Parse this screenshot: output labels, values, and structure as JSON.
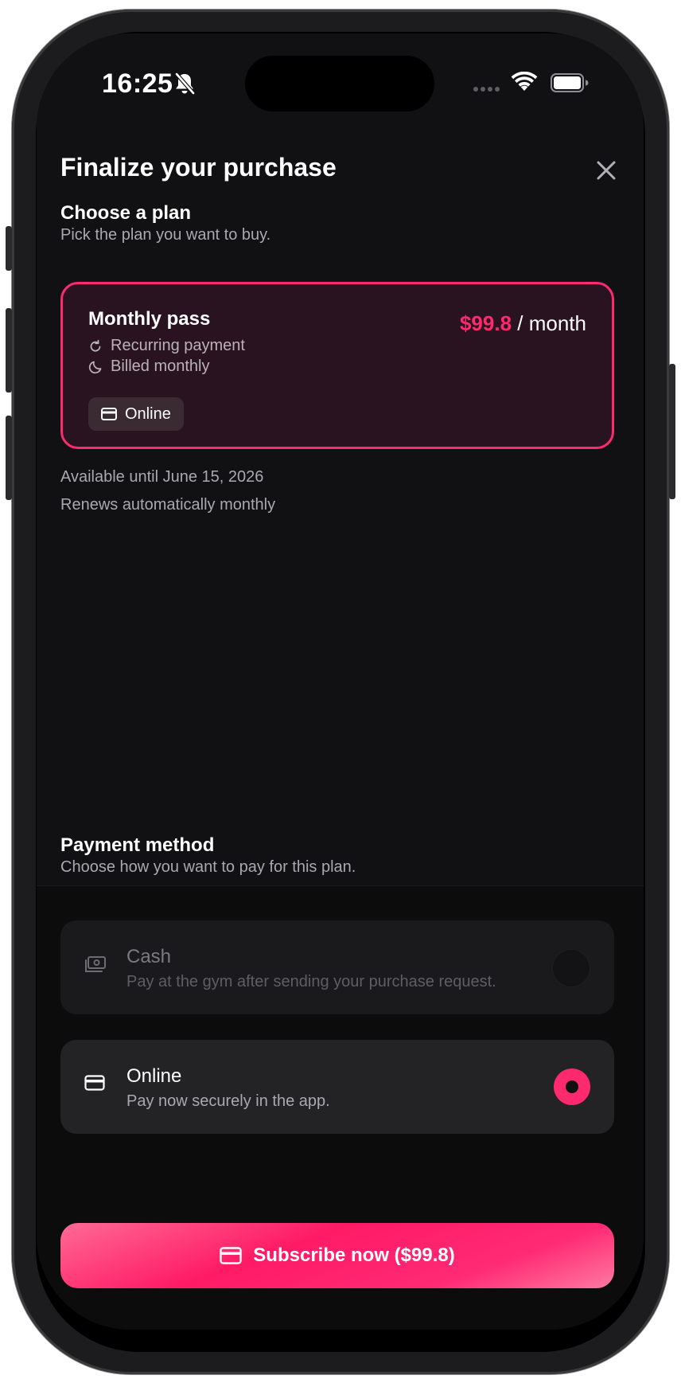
{
  "status_bar": {
    "time": "16:25"
  },
  "header": {
    "title": "Finalize your purchase"
  },
  "plan_section": {
    "title": "Choose a plan",
    "subtitle": "Pick the plan you want to buy.",
    "plan": {
      "name": "Monthly pass",
      "price": "$99.8",
      "period": "/ month",
      "features": [
        "Recurring payment",
        "Billed monthly"
      ],
      "chip": "Online",
      "selected": true
    },
    "availability": "Available until June 15, 2026",
    "renewal": "Renews automatically monthly"
  },
  "payment_section": {
    "title": "Payment method",
    "subtitle": "Choose how you want to pay for this plan.",
    "options": [
      {
        "label": "Cash",
        "description": "Pay at the gym after sending your purchase request.",
        "icon": "cash-icon",
        "selected": false
      },
      {
        "label": "Online",
        "description": "Pay now securely in the app.",
        "icon": "card-icon",
        "selected": true
      }
    ]
  },
  "cta": {
    "label": "Subscribe now ($99.8)"
  },
  "colors": {
    "accent": "#ff2a6d",
    "background": "#111113",
    "card": "#2a1320"
  }
}
